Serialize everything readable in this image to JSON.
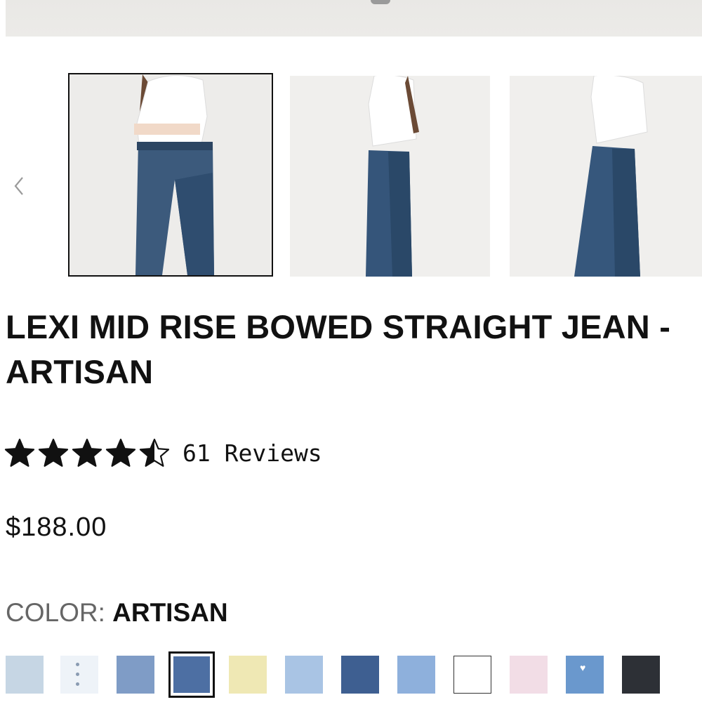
{
  "product": {
    "title": "LEXI MID RISE BOWED STRAIGHT JEAN - ARTISAN",
    "rating_value": 4.5,
    "rating_max": 5,
    "reviews_label": "61 Reviews",
    "price": "$188.00"
  },
  "color": {
    "label": "COLOR:",
    "selected": "ARTISAN",
    "swatches": [
      {
        "color": "#c6d6e4"
      },
      {
        "color": "#eef3f8",
        "detail": "buttons"
      },
      {
        "color": "#7f9cc6"
      },
      {
        "color": "#4d6fa3",
        "selected": true
      },
      {
        "color": "#efe8b4"
      },
      {
        "color": "#a9c4e4",
        "detail": "speckle"
      },
      {
        "color": "#3e5f91"
      },
      {
        "color": "#8eb0dc"
      },
      {
        "color": "#ffffff",
        "bordered": true
      },
      {
        "color": "#f2dde6"
      },
      {
        "color": "#6a98cd",
        "detail": "heart"
      },
      {
        "color": "#2d3036"
      }
    ]
  },
  "gallery": {
    "icons": {
      "prev": "chevron-left-icon"
    },
    "selected_index": 0
  },
  "colors": {
    "text": "#111111",
    "muted": "#666666",
    "selected_border": "#111111"
  }
}
